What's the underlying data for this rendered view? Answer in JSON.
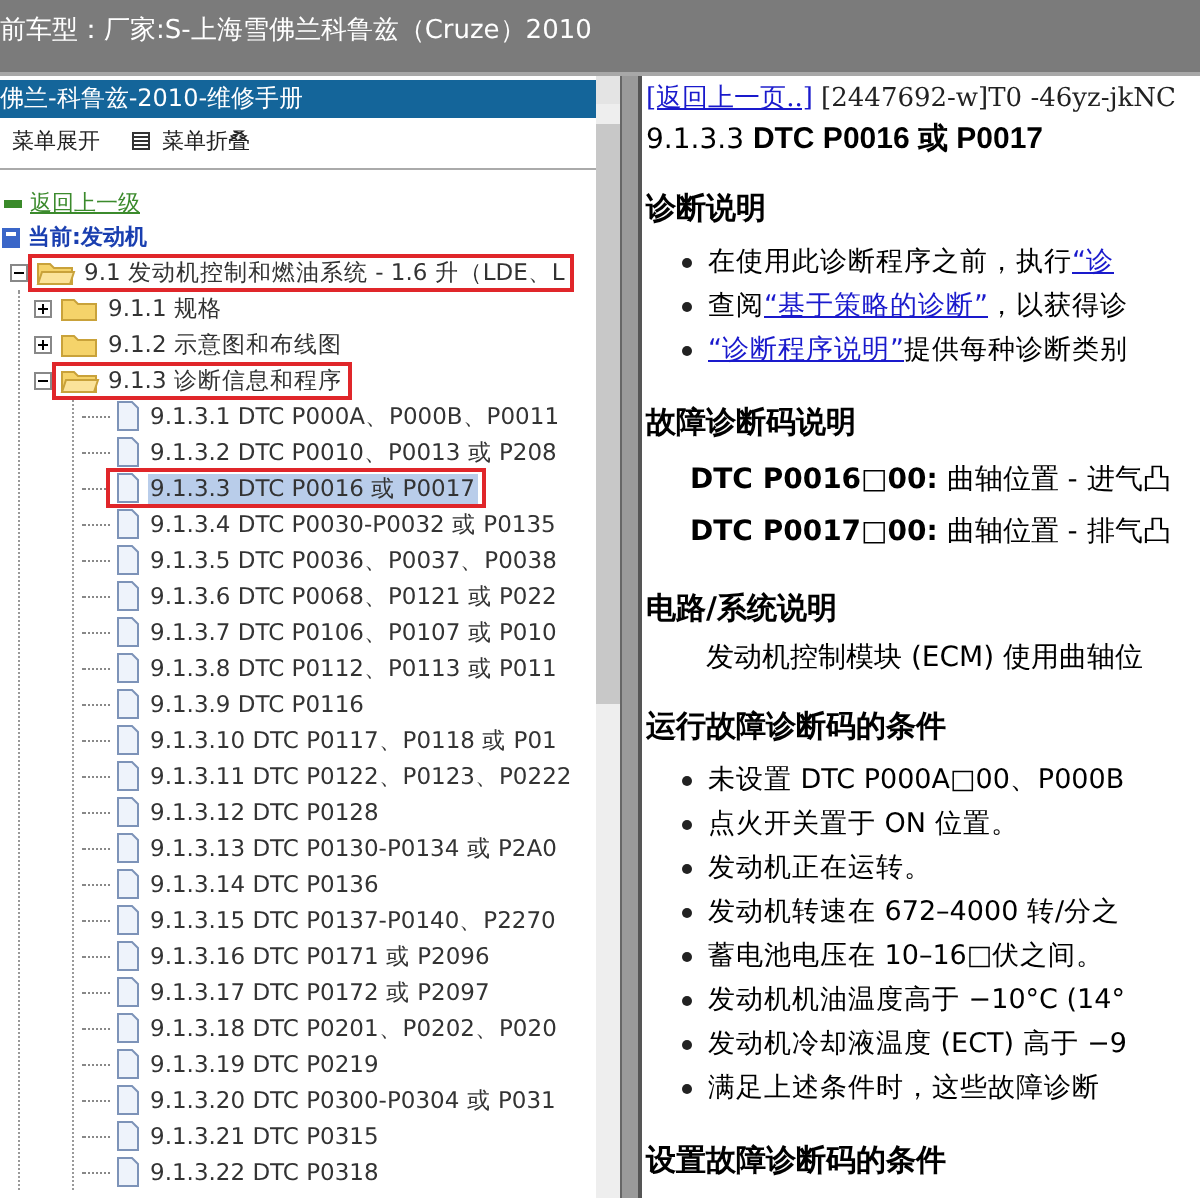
{
  "header": {
    "title": "前车型：厂家:S-上海雪佛兰科鲁兹（Cruze）2010"
  },
  "manual": {
    "title": "佛兰-科鲁兹-2010-维修手册",
    "toolbar": [
      {
        "label": "菜单展开",
        "kind": "expand"
      },
      {
        "label": "菜单折叠",
        "kind": "collapse"
      }
    ],
    "back_link": "返回上一级",
    "current": "当前:发动机",
    "tree": [
      {
        "label": "9.1 发动机控制和燃油系统 - 1.6 升（LDE、L",
        "kind": "folder",
        "expanded": true,
        "marked": true,
        "selected": false,
        "children": [
          {
            "label": "9.1.1 规格",
            "kind": "folder",
            "expanded": false,
            "marked": false,
            "selected": false
          },
          {
            "label": "9.1.2 示意图和布线图",
            "kind": "folder",
            "expanded": false,
            "marked": false,
            "selected": false
          },
          {
            "label": "9.1.3 诊断信息和程序",
            "kind": "folder",
            "expanded": true,
            "marked": true,
            "selected": false,
            "children": [
              {
                "label": "9.1.3.1 DTC P000A、P000B、P0011",
                "kind": "page",
                "marked": false,
                "selected": false
              },
              {
                "label": "9.1.3.2 DTC P0010、P0013 或 P208",
                "kind": "page",
                "marked": false,
                "selected": false
              },
              {
                "label": "9.1.3.3 DTC P0016 或 P0017",
                "kind": "page",
                "marked": true,
                "selected": true
              },
              {
                "label": "9.1.3.4 DTC P0030-P0032 或 P0135",
                "kind": "page",
                "marked": false,
                "selected": false
              },
              {
                "label": "9.1.3.5 DTC P0036、P0037、P0038",
                "kind": "page",
                "marked": false,
                "selected": false
              },
              {
                "label": "9.1.3.6 DTC P0068、P0121 或 P022",
                "kind": "page",
                "marked": false,
                "selected": false
              },
              {
                "label": "9.1.3.7 DTC P0106、P0107 或 P010",
                "kind": "page",
                "marked": false,
                "selected": false
              },
              {
                "label": "9.1.3.8 DTC P0112、P0113 或 P011",
                "kind": "page",
                "marked": false,
                "selected": false
              },
              {
                "label": "9.1.3.9 DTC P0116",
                "kind": "page",
                "marked": false,
                "selected": false
              },
              {
                "label": "9.1.3.10 DTC P0117、P0118 或 P01",
                "kind": "page",
                "marked": false,
                "selected": false
              },
              {
                "label": "9.1.3.11 DTC P0122、P0123、P0222",
                "kind": "page",
                "marked": false,
                "selected": false
              },
              {
                "label": "9.1.3.12 DTC P0128",
                "kind": "page",
                "marked": false,
                "selected": false
              },
              {
                "label": "9.1.3.13 DTC P0130-P0134 或 P2A0",
                "kind": "page",
                "marked": false,
                "selected": false
              },
              {
                "label": "9.1.3.14 DTC P0136",
                "kind": "page",
                "marked": false,
                "selected": false
              },
              {
                "label": "9.1.3.15 DTC P0137-P0140、P2270",
                "kind": "page",
                "marked": false,
                "selected": false
              },
              {
                "label": "9.1.3.16 DTC P0171 或 P2096",
                "kind": "page",
                "marked": false,
                "selected": false
              },
              {
                "label": "9.1.3.17 DTC P0172 或 P2097",
                "kind": "page",
                "marked": false,
                "selected": false
              },
              {
                "label": "9.1.3.18 DTC P0201、P0202、P020",
                "kind": "page",
                "marked": false,
                "selected": false
              },
              {
                "label": "9.1.3.19 DTC P0219",
                "kind": "page",
                "marked": false,
                "selected": false
              },
              {
                "label": "9.1.3.20 DTC P0300-P0304 或 P031",
                "kind": "page",
                "marked": false,
                "selected": false
              },
              {
                "label": "9.1.3.21 DTC P0315",
                "kind": "page",
                "marked": false,
                "selected": false
              },
              {
                "label": "9.1.3.22 DTC P0318",
                "kind": "page",
                "marked": false,
                "selected": false
              }
            ]
          }
        ]
      }
    ]
  },
  "document": {
    "back_link": "[返回上一页..]",
    "doc_id": "[2447692-w]T0 -46yz-jkNC",
    "title": "9.1.3.3 **DTC P0016 或 P0017**",
    "sections": [
      {
        "heading": "诊断说明",
        "kind": "bullets",
        "items": [
          [
            {
              "kind": "text",
              "text": "在使用此诊断程序之前，执行"
            },
            {
              "kind": "link",
              "text": "“诊"
            }
          ],
          [
            {
              "kind": "text",
              "text": "查阅"
            },
            {
              "kind": "link",
              "text": "“基于策略的诊断”"
            },
            {
              "kind": "text",
              "text": "，以获得诊"
            }
          ],
          [
            {
              "kind": "link",
              "text": "“诊断程序说明”"
            },
            {
              "kind": "text",
              "text": "提供每种诊断类别"
            }
          ]
        ]
      },
      {
        "heading": "故障诊断码说明",
        "kind": "codes",
        "items": [
          {
            "code": "DTC P0016□00:",
            "text": "曲轴位置 - 进气凸"
          },
          {
            "code": "DTC P0017□00:",
            "text": "曲轴位置 - 排气凸"
          }
        ]
      },
      {
        "heading": "电路/系统说明",
        "kind": "paragraph",
        "text": "发动机控制模块 (ECM) 使用曲轴位"
      },
      {
        "heading": "运行故障诊断码的条件",
        "kind": "bullets",
        "items": [
          [
            {
              "kind": "text",
              "text": "未设置 DTC P000A□00、P000B"
            }
          ],
          [
            {
              "kind": "text",
              "text": "点火开关置于 ON 位置。"
            }
          ],
          [
            {
              "kind": "text",
              "text": "发动机正在运转。"
            }
          ],
          [
            {
              "kind": "text",
              "text": "发动机转速在 672–4000 转/分之"
            }
          ],
          [
            {
              "kind": "text",
              "text": "蓄电池电压在 10–16□伏之间。"
            }
          ],
          [
            {
              "kind": "text",
              "text": "发动机机油温度高于 −10°C (14°"
            }
          ],
          [
            {
              "kind": "text",
              "text": "发动机冷却液温度 (ECT) 高于 −9"
            }
          ],
          [
            {
              "kind": "text",
              "text": "满足上述条件时，这些故障诊断"
            }
          ]
        ]
      },
      {
        "heading": "设置故障诊断码的条件",
        "kind": "empty"
      }
    ]
  }
}
